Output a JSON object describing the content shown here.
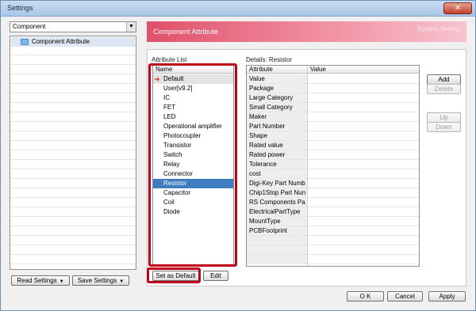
{
  "window": {
    "title": "Settings"
  },
  "left": {
    "combo_value": "Component",
    "tree_items": [
      "Component Attribute"
    ],
    "read_settings": "Read Settings",
    "save_settings": "Save Settings"
  },
  "banner": {
    "title": "Component Attribute",
    "subtitle": "System Setting"
  },
  "attr_list": {
    "label": "Attribute List",
    "header": "Name",
    "items": [
      "Default",
      "User[v9.2]",
      "IC",
      "FET",
      "LED",
      "Operational amplifier",
      "Photocoupler",
      "Transistor",
      "Switch",
      "Relay",
      "Connector",
      "Resistor",
      "Capacitor",
      "Coil",
      "Diode"
    ],
    "default_index": 0,
    "selected_index": 11,
    "set_default": "Set as Default",
    "edit": "Edit"
  },
  "details": {
    "label": "Details: Resistor",
    "col_attribute": "Attribute",
    "col_value": "Value",
    "rows": [
      "Value",
      "Package",
      "Large Category",
      "Small Category",
      "Maker",
      "Part Number",
      "Shape",
      "Rated value",
      "Rated power",
      "Tolerance",
      "cost",
      "Digi-Key Part Numb",
      "Chip1Stop Part Nun",
      "RS Components Pa",
      "ElectricalPartType",
      "MountType",
      "PCBFootprint"
    ]
  },
  "side_buttons": {
    "add": "Add",
    "delete": "Delete",
    "up": "Up",
    "down": "Down"
  },
  "footer": {
    "ok": "O K",
    "cancel": "Cancel",
    "apply": "Apply"
  }
}
